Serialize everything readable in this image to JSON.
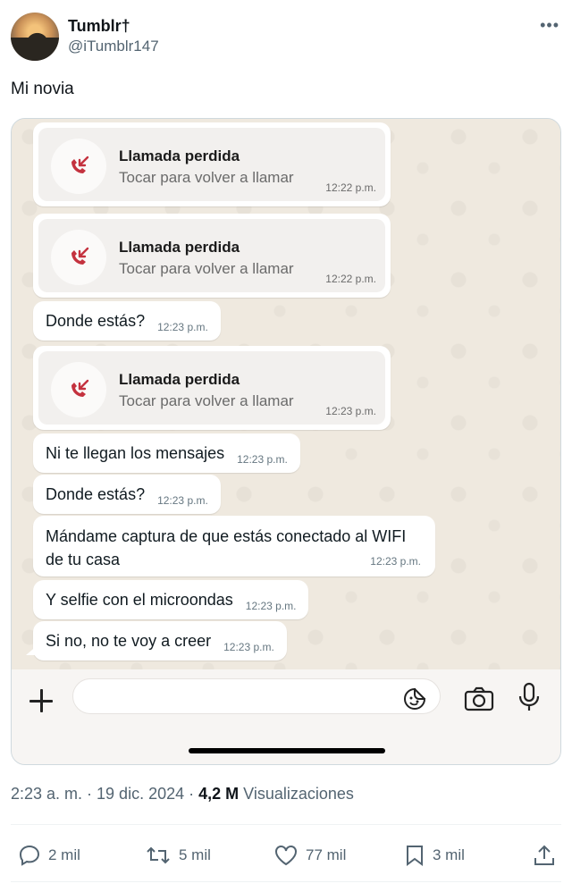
{
  "author": {
    "name": "Tumblr†",
    "handle": "@iTumblr147"
  },
  "more_glyph": "•••",
  "tweet_text": "Mi novia",
  "chat": {
    "calls": [
      {
        "title": "Llamada perdida",
        "subtitle": "Tocar para volver a llamar",
        "time": "12:22 p.m."
      },
      {
        "title": "Llamada perdida",
        "subtitle": "Tocar para volver a llamar",
        "time": "12:22 p.m."
      },
      {
        "title": "Llamada perdida",
        "subtitle": "Tocar para volver a llamar",
        "time": "12:23 p.m."
      }
    ],
    "messages": [
      {
        "text": "Donde estás?",
        "time": "12:23 p.m."
      },
      {
        "text": "Ni te llegan los mensajes",
        "time": "12:23 p.m."
      },
      {
        "text": "Donde estás?",
        "time": "12:23 p.m."
      },
      {
        "text": "Mándame captura de que estás conectado al WIFI de tu casa",
        "time": "12:23 p.m."
      },
      {
        "text": "Y selfie con el microondas",
        "time": "12:23 p.m."
      },
      {
        "text": "Si no, no te voy a creer",
        "time": "12:23 p.m."
      }
    ],
    "input_placeholder": ""
  },
  "meta": {
    "time_date": "2:23 a. m. · 19 dic. 2024 · ",
    "views_count": "4,2 M",
    "views_label": " Visualizaciones"
  },
  "actions": {
    "replies": "2 mil",
    "reposts": "5 mil",
    "likes": "77 mil",
    "bookmarks": "3 mil"
  },
  "colors": {
    "missed_call_red": "#c4323f",
    "chat_bg": "#efe9df",
    "secondary_text": "#536471"
  }
}
